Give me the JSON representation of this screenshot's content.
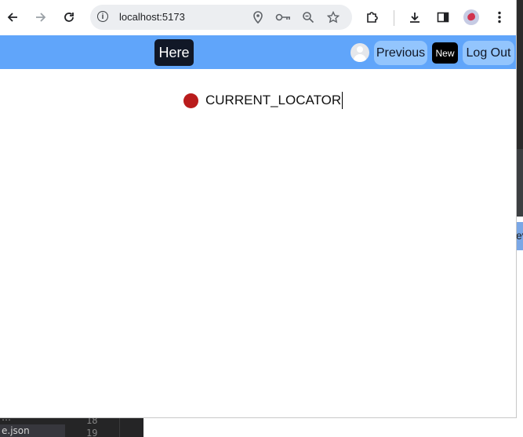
{
  "browser": {
    "url": "localhost:5173",
    "icons": {
      "back": "arrow-left-icon",
      "forward": "arrow-right-icon",
      "reload": "reload-icon",
      "site_info": "info-icon",
      "location": "location-pin-icon",
      "password": "key-icon",
      "zoom": "zoom-icon",
      "bookmark": "star-icon",
      "extensions": "puzzle-icon",
      "download": "download-icon",
      "side_panel": "side-panel-icon",
      "menu": "kebab-menu-icon"
    }
  },
  "app": {
    "here_label": "Here",
    "previous_label": "Previous",
    "new_label": "New",
    "logout_label": "Log Out",
    "locator_text": "CURRENT_LOCATOR",
    "colors": {
      "navbar": "#60a5fa",
      "pill": "#93c5fd",
      "here_bg": "#111827",
      "new_bg": "#000000",
      "status_dot": "#b91c1c"
    }
  },
  "background": {
    "file_label": "e.json",
    "line_numbers": [
      "18",
      "19"
    ]
  }
}
